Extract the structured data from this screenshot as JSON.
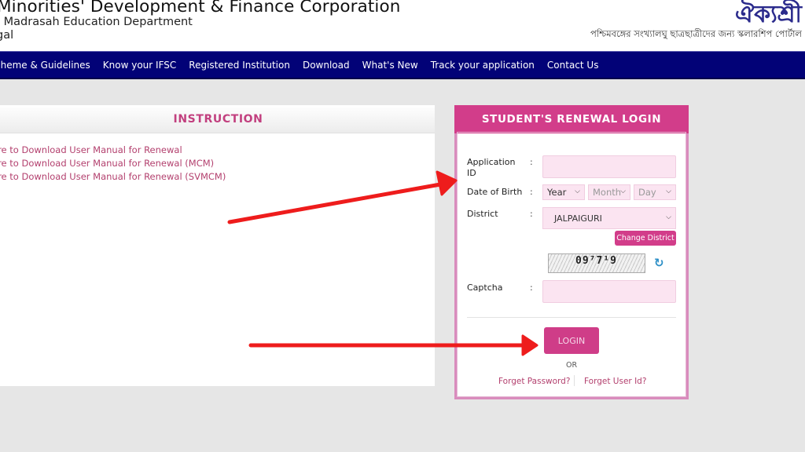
{
  "header": {
    "title": "Minorities' Development & Finance Corporation",
    "subtitle_line1": "l Madrasah Education Department",
    "subtitle_line2": "gal",
    "logo_text": "ঐক্যশ্রী",
    "logo_tagline": "পশ্চিমবঙ্গের সংখ্যালঘু ছাত্রছাত্রীদের জন্য স্কলারশিপ পোর্টাল"
  },
  "nav": {
    "items": [
      {
        "label": "cheme & Guidelines"
      },
      {
        "label": "Know your IFSC"
      },
      {
        "label": "Registered Institution"
      },
      {
        "label": "Download"
      },
      {
        "label": "What's New"
      },
      {
        "label": "Track your application"
      },
      {
        "label": "Contact Us"
      }
    ]
  },
  "instruction": {
    "title": "INSTRUCTION",
    "links": [
      {
        "label": "ere to Download User Manual for Renewal"
      },
      {
        "label": "ere to Download User Manual for Renewal (MCM)"
      },
      {
        "label": "ere to Download User Manual for Renewal (SVMCM)"
      }
    ]
  },
  "login": {
    "title": "STUDENT'S RENEWAL LOGIN",
    "application_id": {
      "label_line1": "Application",
      "label_line2": "ID",
      "value": ""
    },
    "dob": {
      "label": "Date of Birth",
      "year": "Year",
      "month": "Month",
      "day": "Day"
    },
    "district": {
      "label": "District",
      "value": "JALPAIGURI"
    },
    "change_district": "Change District",
    "captcha": {
      "label": "Captcha",
      "image_text": "09⁷7¹9",
      "value": ""
    },
    "colon": ":",
    "login_button": "LOGIN",
    "or": "OR",
    "forgot_password": "Forget Password?",
    "forgot_user_id": "Forget User Id?"
  },
  "colors": {
    "nav_bg": "#020277",
    "accent_pink": "#d23d8a",
    "input_bg": "#fbe4f1",
    "link_color": "#b3406e",
    "annotation_arrow": "#ee1c1c"
  }
}
